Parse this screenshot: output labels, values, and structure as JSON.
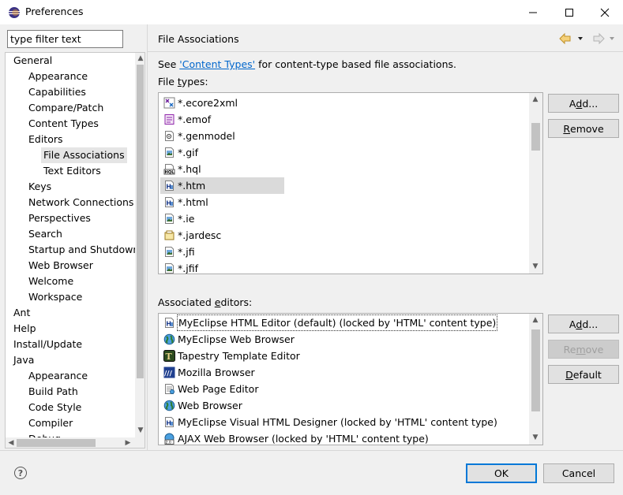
{
  "window": {
    "title": "Preferences",
    "icon": "eclipse-icon"
  },
  "filter": {
    "placeholder": "type filter text",
    "value": "type filter text"
  },
  "tree": {
    "items": [
      {
        "label": "General",
        "level": 0,
        "selected": false
      },
      {
        "label": "Appearance",
        "level": 1,
        "selected": false
      },
      {
        "label": "Capabilities",
        "level": 1,
        "selected": false
      },
      {
        "label": "Compare/Patch",
        "level": 1,
        "selected": false
      },
      {
        "label": "Content Types",
        "level": 1,
        "selected": false
      },
      {
        "label": "Editors",
        "level": 1,
        "selected": false
      },
      {
        "label": "File Associations",
        "level": 2,
        "selected": true
      },
      {
        "label": "Text Editors",
        "level": 2,
        "selected": false
      },
      {
        "label": "Keys",
        "level": 1,
        "selected": false
      },
      {
        "label": "Network Connections",
        "level": 1,
        "selected": false
      },
      {
        "label": "Perspectives",
        "level": 1,
        "selected": false
      },
      {
        "label": "Search",
        "level": 1,
        "selected": false
      },
      {
        "label": "Startup and Shutdown",
        "level": 1,
        "selected": false
      },
      {
        "label": "Web Browser",
        "level": 1,
        "selected": false
      },
      {
        "label": "Welcome",
        "level": 1,
        "selected": false
      },
      {
        "label": "Workspace",
        "level": 1,
        "selected": false
      },
      {
        "label": "Ant",
        "level": 0,
        "selected": false
      },
      {
        "label": "Help",
        "level": 0,
        "selected": false
      },
      {
        "label": "Install/Update",
        "level": 0,
        "selected": false
      },
      {
        "label": "Java",
        "level": 0,
        "selected": false
      },
      {
        "label": "Appearance",
        "level": 1,
        "selected": false
      },
      {
        "label": "Build Path",
        "level": 1,
        "selected": false
      },
      {
        "label": "Code Style",
        "level": 1,
        "selected": false
      },
      {
        "label": "Compiler",
        "level": 1,
        "selected": false
      },
      {
        "label": "Debug",
        "level": 1,
        "selected": false
      }
    ]
  },
  "page": {
    "title": "File Associations",
    "see_prefix": "See ",
    "see_link": "'Content Types'",
    "see_suffix": " for content-type based file associations.",
    "file_types_label": "File types:",
    "file_types_label_pre": "File ",
    "file_types_label_ul": "t",
    "file_types_label_post": "ypes:",
    "assoc_label_pre": "Associated ",
    "assoc_label_ul": "e",
    "assoc_label_post": "ditors:"
  },
  "file_types": [
    {
      "label": "*.ecore2xml",
      "icon": "ecore-file-icon",
      "selected": false
    },
    {
      "label": "*.emof",
      "icon": "emof-file-icon",
      "selected": false
    },
    {
      "label": "*.genmodel",
      "icon": "genmodel-file-icon",
      "selected": false
    },
    {
      "label": "*.gif",
      "icon": "image-file-icon",
      "selected": false
    },
    {
      "label": "*.hql",
      "icon": "hql-file-icon",
      "selected": false
    },
    {
      "label": "*.htm",
      "icon": "html-file-icon",
      "selected": true
    },
    {
      "label": "*.html",
      "icon": "html-file-icon",
      "selected": false
    },
    {
      "label": "*.ie",
      "icon": "image-file-icon",
      "selected": false
    },
    {
      "label": "*.jardesc",
      "icon": "jardesc-file-icon",
      "selected": false
    },
    {
      "label": "*.jfi",
      "icon": "image-file-icon",
      "selected": false
    },
    {
      "label": "*.jfif",
      "icon": "image-file-icon",
      "selected": false
    }
  ],
  "editors": [
    {
      "label": "MyEclipse HTML Editor (default) (locked by 'HTML' content type)",
      "icon": "html-editor-icon",
      "focused": true
    },
    {
      "label": "MyEclipse Web Browser",
      "icon": "globe-icon",
      "focused": false
    },
    {
      "label": "Tapestry Template Editor",
      "icon": "tapestry-icon",
      "focused": false
    },
    {
      "label": "Mozilla Browser",
      "icon": "mozilla-icon",
      "focused": false
    },
    {
      "label": "Web Page Editor",
      "icon": "web-page-editor-icon",
      "focused": false
    },
    {
      "label": "Web Browser",
      "icon": "globe-icon",
      "focused": false
    },
    {
      "label": "MyEclipse Visual HTML Designer (locked by 'HTML' content type)",
      "icon": "html-editor-icon",
      "focused": false
    },
    {
      "label": "AJAX Web Browser (locked by 'HTML' content type)",
      "icon": "ajax-browser-icon",
      "focused": false
    }
  ],
  "buttons": {
    "add_types_pre": "A",
    "add_types_ul": "d",
    "add_types_post": "d...",
    "remove_types_pre": "",
    "remove_types_ul": "R",
    "remove_types_post": "emove",
    "add_editors_pre": "A",
    "add_editors_ul": "d",
    "add_editors_post": "d...",
    "remove_editors_pre": "Re",
    "remove_editors_ul": "m",
    "remove_editors_post": "ove",
    "default_pre": "",
    "default_ul": "D",
    "default_post": "efault",
    "ok": "OK",
    "cancel": "Cancel"
  },
  "help": {
    "glyph": "?"
  },
  "colors": {
    "link": "#0066cc",
    "default_button_border": "#0078d7",
    "selection": "#dadada"
  }
}
